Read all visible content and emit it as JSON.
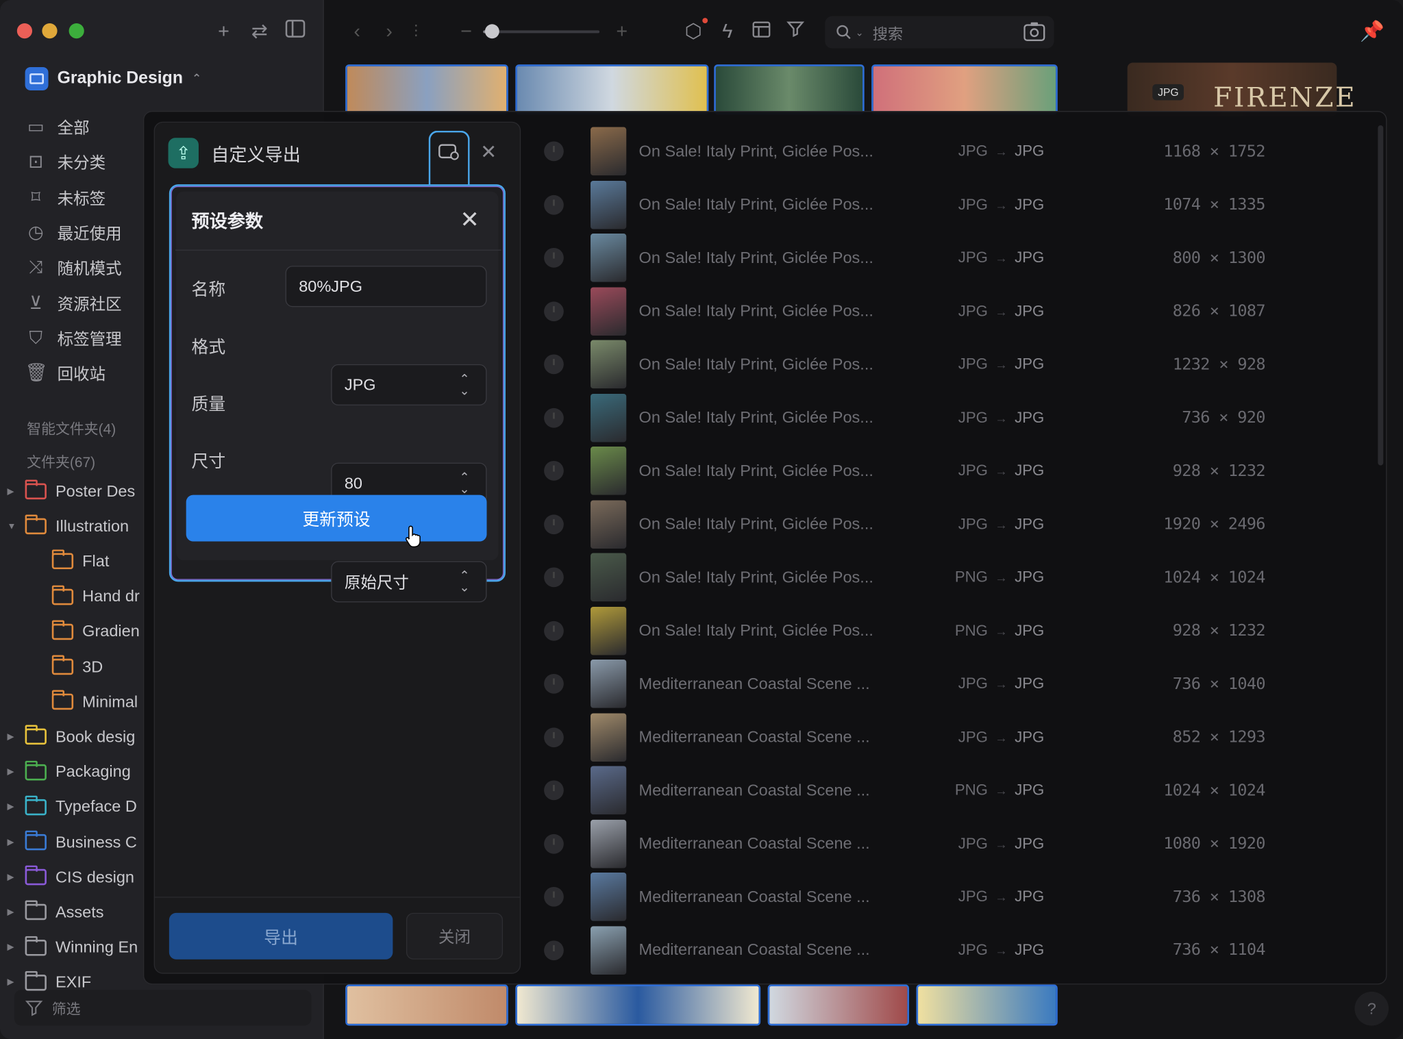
{
  "sidebar": {
    "library_name": "Graphic Design",
    "nav": [
      {
        "label": "全部",
        "icon": "inbox-icon"
      },
      {
        "label": "未分类",
        "icon": "folder-question-icon"
      },
      {
        "label": "未标签",
        "icon": "tag-off-icon"
      },
      {
        "label": "最近使用",
        "icon": "clock-icon"
      },
      {
        "label": "随机模式",
        "icon": "shuffle-icon"
      },
      {
        "label": "资源社区",
        "icon": "download-box-icon"
      },
      {
        "label": "标签管理",
        "icon": "bookmark-icon"
      },
      {
        "label": "回收站",
        "icon": "trash-icon"
      }
    ],
    "smart_folders": "智能文件夹(4)",
    "folders_header": "文件夹(67)",
    "folders": [
      {
        "label": "Poster Des",
        "color": "#d9534f",
        "expanded": false,
        "child": false
      },
      {
        "label": "Illustration",
        "color": "#e08a3c",
        "expanded": true,
        "child": false
      },
      {
        "label": "Flat",
        "color": "#e08a3c",
        "child": true
      },
      {
        "label": "Hand dr",
        "color": "#e08a3c",
        "child": true
      },
      {
        "label": "Gradien",
        "color": "#e08a3c",
        "child": true
      },
      {
        "label": "3D",
        "color": "#e08a3c",
        "child": true
      },
      {
        "label": "Minimal",
        "color": "#e08a3c",
        "child": true
      },
      {
        "label": "Book desig",
        "color": "#e8c33c",
        "expanded": false,
        "child": false
      },
      {
        "label": "Packaging",
        "color": "#4caf50",
        "expanded": false,
        "child": false
      },
      {
        "label": "Typeface D",
        "color": "#3ab3c9",
        "expanded": false,
        "child": false
      },
      {
        "label": "Business C",
        "color": "#3a7bd5",
        "expanded": false,
        "child": false
      },
      {
        "label": "CIS design",
        "color": "#8a5ad8",
        "expanded": false,
        "child": false
      },
      {
        "label": "Assets",
        "color": "#9a9aa0",
        "expanded": false,
        "child": false
      },
      {
        "label": "Winning En",
        "color": "#9a9aa0",
        "expanded": false,
        "child": false
      },
      {
        "label": "EXIF",
        "color": "#9a9aa0",
        "expanded": false,
        "child": false
      }
    ],
    "filter_label": "筛选"
  },
  "toolbar": {
    "search_placeholder": "搜索",
    "zoom_level": 0.08
  },
  "export_panel": {
    "title": "自定义导出",
    "export_label": "导出",
    "close_label": "关闭"
  },
  "preset": {
    "title": "预设参数",
    "name_label": "名称",
    "name_value": "80%JPG",
    "format_label": "格式",
    "format_value": "JPG",
    "quality_label": "质量",
    "quality_value": "80",
    "size_label": "尺寸",
    "size_value": "原始尺寸",
    "update_label": "更新预设"
  },
  "files": [
    {
      "name": "On Sale! Italy Print, Giclée Pos...",
      "from": "JPG",
      "to": "JPG",
      "size": "1168 × 1752",
      "thumb": "#8a6a4a"
    },
    {
      "name": "On Sale! Italy Print, Giclée Pos...",
      "from": "JPG",
      "to": "JPG",
      "size": "1074 × 1335",
      "thumb": "#5a7a9a"
    },
    {
      "name": "On Sale! Italy Print, Giclée Pos...",
      "from": "JPG",
      "to": "JPG",
      "size": "800 × 1300",
      "thumb": "#6a8aa0"
    },
    {
      "name": "On Sale! Italy Print, Giclée Pos...",
      "from": "JPG",
      "to": "JPG",
      "size": "826 × 1087",
      "thumb": "#9a4a5a"
    },
    {
      "name": "On Sale! Italy Print, Giclée Pos...",
      "from": "JPG",
      "to": "JPG",
      "size": "1232 × 928",
      "thumb": "#7a8a6a"
    },
    {
      "name": "On Sale! Italy Print, Giclée Pos...",
      "from": "JPG",
      "to": "JPG",
      "size": "736 × 920",
      "thumb": "#3a6a7a"
    },
    {
      "name": "On Sale! Italy Print, Giclée Pos...",
      "from": "JPG",
      "to": "JPG",
      "size": "928 × 1232",
      "thumb": "#6a8a4a"
    },
    {
      "name": "On Sale! Italy Print, Giclée Pos...",
      "from": "JPG",
      "to": "JPG",
      "size": "1920 × 2496",
      "thumb": "#7a6a5a"
    },
    {
      "name": "On Sale! Italy Print, Giclée Pos...",
      "from": "PNG",
      "to": "JPG",
      "size": "1024 × 1024",
      "thumb": "#4a5a4a"
    },
    {
      "name": "On Sale! Italy Print, Giclée Pos...",
      "from": "PNG",
      "to": "JPG",
      "size": "928 × 1232",
      "thumb": "#b09a3a"
    },
    {
      "name": "Mediterranean Coastal Scene ...",
      "from": "JPG",
      "to": "JPG",
      "size": "736 × 1040",
      "thumb": "#8a9aaa"
    },
    {
      "name": "Mediterranean Coastal Scene ...",
      "from": "JPG",
      "to": "JPG",
      "size": "852 × 1293",
      "thumb": "#a08a6a"
    },
    {
      "name": "Mediterranean Coastal Scene ...",
      "from": "PNG",
      "to": "JPG",
      "size": "1024 × 1024",
      "thumb": "#5a6a8a"
    },
    {
      "name": "Mediterranean Coastal Scene ...",
      "from": "JPG",
      "to": "JPG",
      "size": "1080 × 1920",
      "thumb": "#9aa0aa"
    },
    {
      "name": "Mediterranean Coastal Scene ...",
      "from": "JPG",
      "to": "JPG",
      "size": "736 × 1308",
      "thumb": "#5a7aa0"
    },
    {
      "name": "Mediterranean Coastal Scene ...",
      "from": "JPG",
      "to": "JPG",
      "size": "736 × 1104",
      "thumb": "#8aa0b0"
    }
  ],
  "inspector": {
    "badge": "JPG",
    "preview_text": "FIRENZE"
  }
}
